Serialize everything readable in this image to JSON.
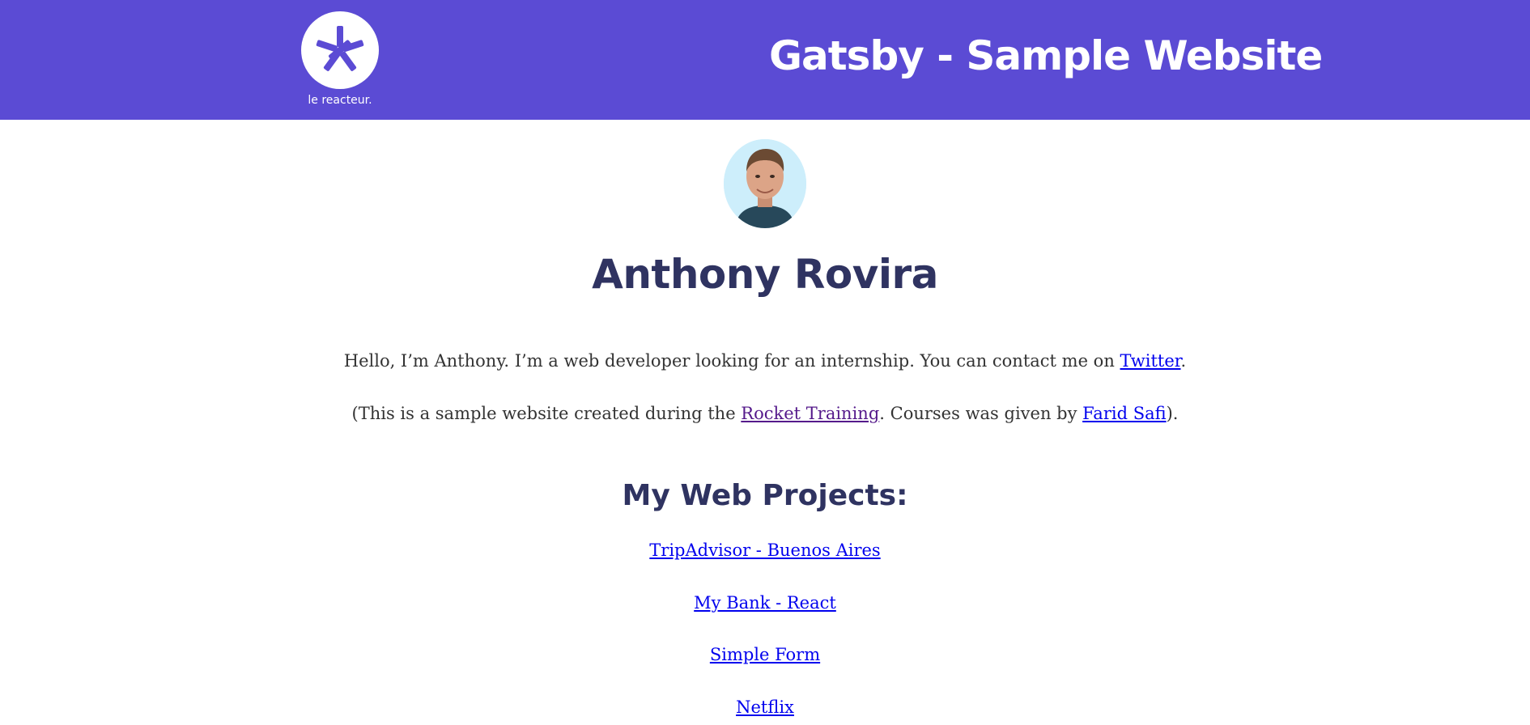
{
  "header": {
    "background_color": "#5b4bd4",
    "logo_text": "le reacteur.",
    "logo_icon": "le-reacteur-logo-icon",
    "title": "Gatsby - Sample Website"
  },
  "profile": {
    "avatar_icon": "profile-photo",
    "name": "Anthony Rovira"
  },
  "intro": {
    "text_before": "Hello, I’m Anthony. I’m a web developer looking for an internship. You can contact me on ",
    "twitter_link": "Twitter",
    "text_after": "."
  },
  "note": {
    "text_1": "(This is a sample website created during the ",
    "rocket_link": "Rocket Training",
    "text_2": ". Courses was given by ",
    "farid_link": "Farid Safi",
    "text_3": ")."
  },
  "projects": {
    "title": "My Web Projects:",
    "items": [
      {
        "label": "TripAdvisor - Buenos Aires"
      },
      {
        "label": "My Bank - React"
      },
      {
        "label": "Simple Form"
      },
      {
        "label": "Netflix"
      }
    ]
  },
  "colors": {
    "heading": "#2f3361",
    "link": "#0000ee",
    "visited_link": "#551a8b"
  }
}
